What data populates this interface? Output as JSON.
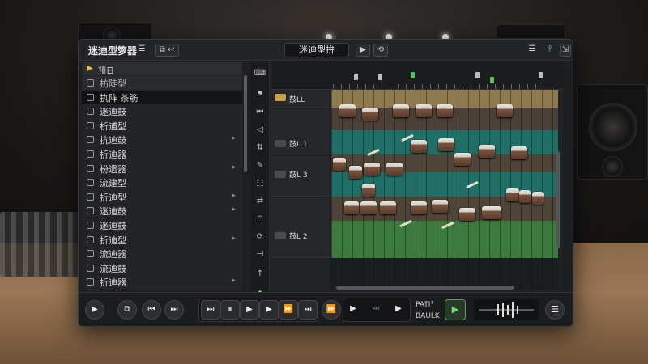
{
  "window": {
    "app_title": "迷迪型箩器",
    "project_name": "迷迪型拚"
  },
  "sidebar": {
    "header_label": "预日",
    "items": [
      {
        "label": "枋陡型",
        "style": "hdr",
        "arrow": ""
      },
      {
        "label": "执阵 茶筋",
        "style": "sel",
        "arrow": ""
      },
      {
        "label": "迷迪鼓",
        "style": "",
        "arrow": ""
      },
      {
        "label": "析逋型",
        "style": "",
        "arrow": ""
      },
      {
        "label": "抗迪鼓",
        "style": "",
        "arrow": "▸"
      },
      {
        "label": "折迪器",
        "style": "",
        "arrow": ""
      },
      {
        "label": "枌遗器",
        "style": "",
        "arrow": "▸"
      },
      {
        "label": "流建型",
        "style": "",
        "arrow": ""
      },
      {
        "label": "折迪型",
        "style": "",
        "arrow": "▸"
      },
      {
        "label": "迷迪鼓",
        "style": "",
        "arrow": "▸"
      },
      {
        "label": "迷迪鼓",
        "style": "",
        "arrow": ""
      },
      {
        "label": "折迪型",
        "style": "",
        "arrow": "▸"
      },
      {
        "label": "流迪器",
        "style": "",
        "arrow": ""
      },
      {
        "label": "流迪鼓",
        "style": "",
        "arrow": ""
      },
      {
        "label": "折迪器",
        "style": "",
        "arrow": "▸"
      }
    ]
  },
  "tracks": [
    {
      "name": "鼓LL"
    },
    {
      "name": "鼓L 1"
    },
    {
      "name": "鼓L 3"
    },
    {
      "name": "鼓L 2"
    }
  ],
  "lane_colors": {
    "lane_top": "#8f7a4f",
    "lane_green": "#3d7a3d",
    "lane_teal": "#1f6f66",
    "lane_brown": "#4f4438",
    "accent_green": "#6fe06f"
  },
  "transport": {
    "pattern_label_line1": "PATI⁷",
    "pattern_label_line2": "BAULK"
  }
}
